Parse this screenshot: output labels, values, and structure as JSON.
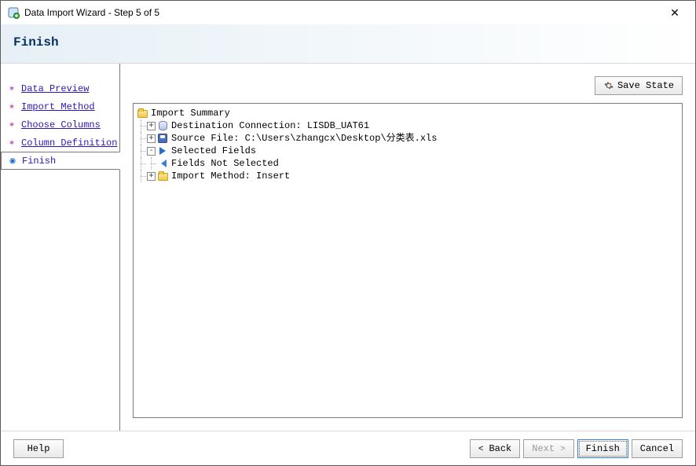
{
  "window": {
    "title": "Data Import Wizard - Step 5 of 5"
  },
  "header": {
    "heading": "Finish"
  },
  "steps": {
    "preview": "Data Preview",
    "method": "Import Method",
    "columns": "Choose Columns",
    "definition": "Column Definition",
    "finish": "Finish"
  },
  "buttons": {
    "save_state": "Save State",
    "help": "Help",
    "back": "Back",
    "next": "Next",
    "finish": "Finish",
    "cancel": "Cancel"
  },
  "tree": {
    "root": "Import Summary",
    "destination": "Destination Connection: LISDB_UAT61",
    "source_file": "Source File: C:\\Users\\zhangcx\\Desktop\\分类表.xls",
    "selected_fields": "Selected Fields",
    "fields_not_selected": "Fields Not Selected",
    "import_method": "Import Method: Insert"
  }
}
